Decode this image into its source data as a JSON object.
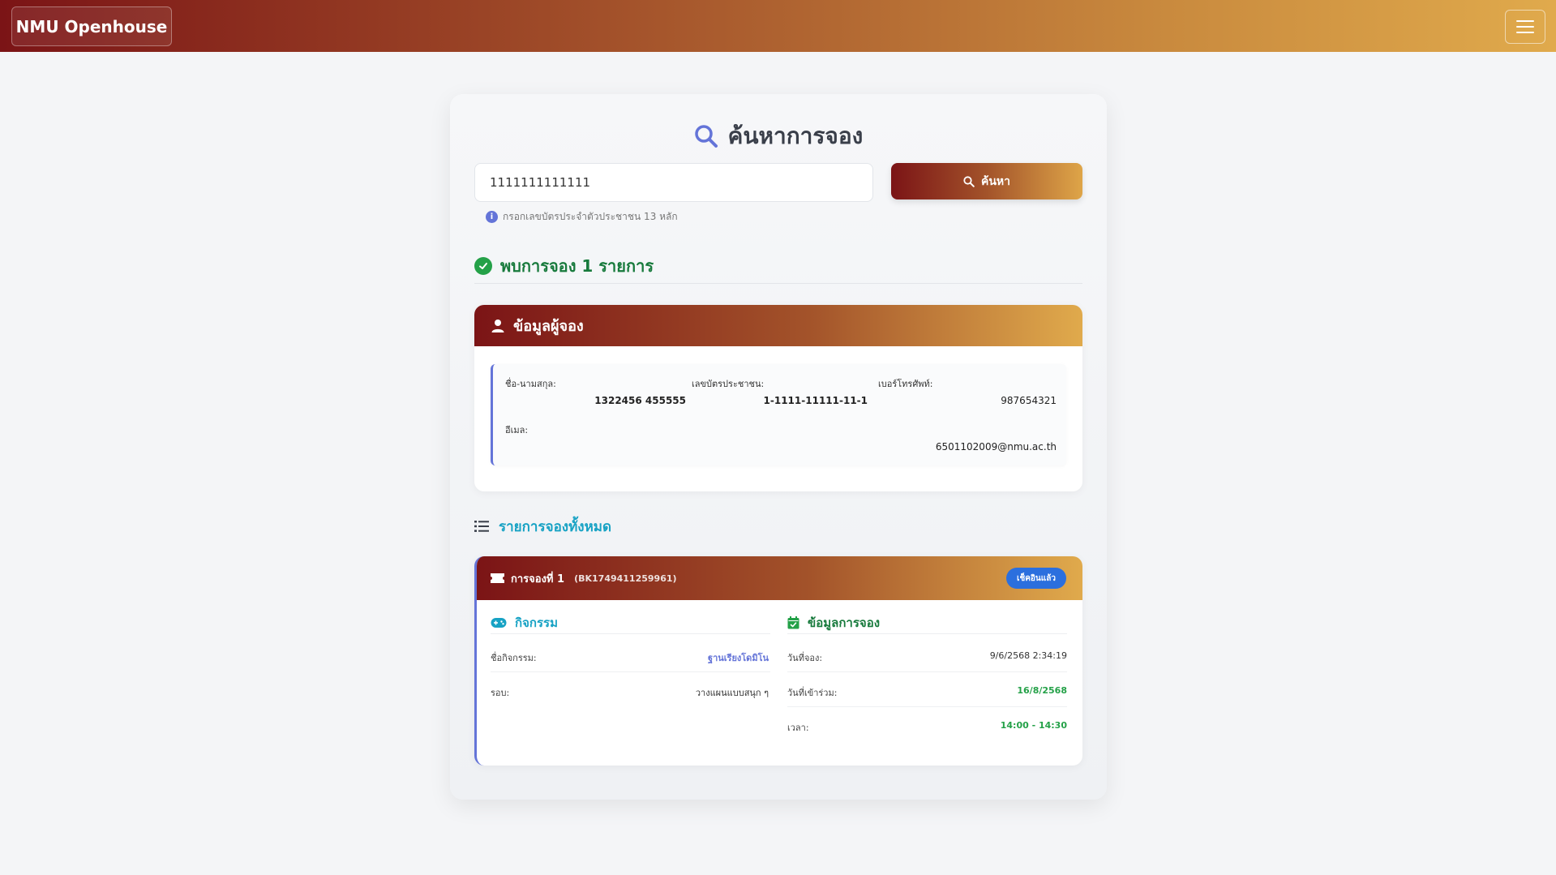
{
  "navbar": {
    "brand": "NMU Openhouse"
  },
  "search": {
    "title": "ค้นหาการจอง",
    "input_value": "1111111111111",
    "button_label": "ค้นหา",
    "hint": "กรอกเลขบัตรประจำตัวประชาชน 13 หลัก"
  },
  "result": {
    "found_text": "พบการจอง 1 รายการ"
  },
  "booker": {
    "header": "ข้อมูลผู้จอง",
    "name_label": "ชื่อ-นามสกุล:",
    "name_value": "1322456 455555",
    "id_label": "เลขบัตรประชาชน:",
    "id_value": "1-1111-11111-11-1",
    "phone_label": "เบอร์โทรศัพท์:",
    "phone_value": "987654321",
    "email_label": "อีเมล:",
    "email_value": "6501102009@nmu.ac.th"
  },
  "bookings_section": {
    "title": "รายการจองทั้งหมด"
  },
  "booking": {
    "title": "การจองที่ 1",
    "code": "(BK1749411259961)",
    "status": "เช็คอินแล้ว",
    "activity_header": "กิจกรรม",
    "activity_name_label": "ชื่อกิจกรรม:",
    "activity_name_value": "ฐานเรียงโดมิโน",
    "round_label": "รอบ:",
    "round_value": "วางแผนแบบสนุก ๆ",
    "info_header": "ข้อมูลการจอง",
    "booking_date_label": "วันที่จอง:",
    "booking_date_value": "9/6/2568 2:34:19",
    "attend_date_label": "วันที่เข้าร่วม:",
    "attend_date_value": "16/8/2568",
    "time_label": "เวลา:",
    "time_value": "14:00 - 14:30"
  },
  "colors": {
    "brand_dark": "#7b1416",
    "brand_gold": "#e0aa4c",
    "accent_blue": "#6474d8",
    "success_green": "#24a148",
    "badge_blue": "#2b6fde",
    "info_cyan": "#17a2c4"
  },
  "icons": {
    "search": "magnifier-icon",
    "info": "info-icon",
    "check": "check-circle-icon",
    "user": "user-icon",
    "list": "list-icon",
    "ticket": "ticket-icon",
    "gamepad": "gamepad-icon",
    "calendar": "calendar-check-icon",
    "menu": "hamburger-icon"
  }
}
